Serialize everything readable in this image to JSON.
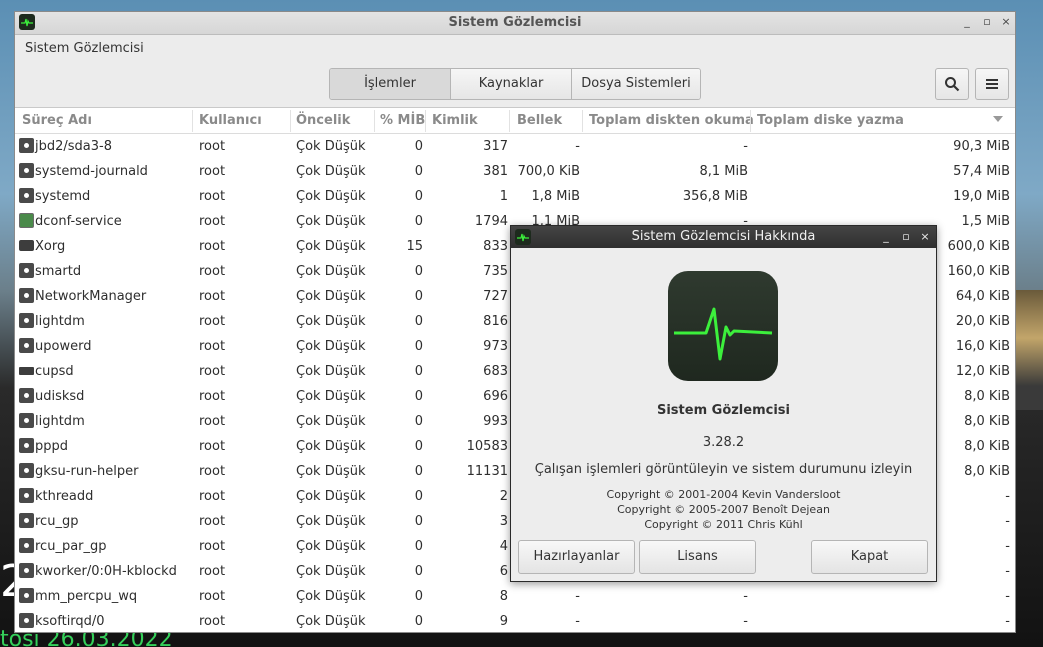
{
  "desktop": {
    "left_text": "2",
    "bottom_text": "tosi 26.03.2022"
  },
  "window": {
    "title": "Sistem Gözlemcisi",
    "menu_label": "Sistem Gözlemcisi",
    "minimize_label": "_",
    "maximize_label": "▫",
    "close_label": "×"
  },
  "toolbar": {
    "tabs": [
      {
        "label": "İşlemler",
        "active": true
      },
      {
        "label": "Kaynaklar",
        "active": false
      },
      {
        "label": "Dosya Sistemleri",
        "active": false
      }
    ]
  },
  "columns": [
    "Süreç Adı",
    "Kullanıcı",
    "Öncelik",
    "% MİB",
    "Kimlik",
    "Bellek",
    "Toplam diskten okuma",
    "Toplam diske yazma"
  ],
  "processes": [
    {
      "icon": "gear",
      "name": "jbd2/sda3-8",
      "user": "root",
      "priority": "Çok Düşük",
      "cpu": "0",
      "pid": "317",
      "memory": "-",
      "read": "-",
      "write": "90,3 MiB"
    },
    {
      "icon": "gear",
      "name": "systemd-journald",
      "user": "root",
      "priority": "Çok Düşük",
      "cpu": "0",
      "pid": "381",
      "memory": "700,0 KiB",
      "read": "8,1 MiB",
      "write": "57,4 MiB"
    },
    {
      "icon": "gear",
      "name": "systemd",
      "user": "root",
      "priority": "Çok Düşük",
      "cpu": "0",
      "pid": "1",
      "memory": "1,8 MiB",
      "read": "356,8 MiB",
      "write": "19,0 MiB"
    },
    {
      "icon": "dconf",
      "name": "dconf-service",
      "user": "root",
      "priority": "Çok Düşük",
      "cpu": "0",
      "pid": "1794",
      "memory": "1,1 MiB",
      "read": "-",
      "write": "1,5 MiB"
    },
    {
      "icon": "screen",
      "name": "Xorg",
      "user": "root",
      "priority": "Çok Düşük",
      "cpu": "15",
      "pid": "833",
      "memory": "",
      "read": "",
      "write": "600,0 KiB"
    },
    {
      "icon": "gear",
      "name": "smartd",
      "user": "root",
      "priority": "Çok Düşük",
      "cpu": "0",
      "pid": "735",
      "memory": "",
      "read": "",
      "write": "160,0 KiB"
    },
    {
      "icon": "gear",
      "name": "NetworkManager",
      "user": "root",
      "priority": "Çok Düşük",
      "cpu": "0",
      "pid": "727",
      "memory": "",
      "read": "",
      "write": "64,0 KiB"
    },
    {
      "icon": "gear",
      "name": "lightdm",
      "user": "root",
      "priority": "Çok Düşük",
      "cpu": "0",
      "pid": "816",
      "memory": "",
      "read": "",
      "write": "20,0 KiB"
    },
    {
      "icon": "gear",
      "name": "upowerd",
      "user": "root",
      "priority": "Çok Düşük",
      "cpu": "0",
      "pid": "973",
      "memory": "",
      "read": "",
      "write": "16,0 KiB"
    },
    {
      "icon": "printer",
      "name": "cupsd",
      "user": "root",
      "priority": "Çok Düşük",
      "cpu": "0",
      "pid": "683",
      "memory": "",
      "read": "",
      "write": "12,0 KiB"
    },
    {
      "icon": "gear",
      "name": "udisksd",
      "user": "root",
      "priority": "Çok Düşük",
      "cpu": "0",
      "pid": "696",
      "memory": "",
      "read": "",
      "write": "8,0 KiB"
    },
    {
      "icon": "gear",
      "name": "lightdm",
      "user": "root",
      "priority": "Çok Düşük",
      "cpu": "0",
      "pid": "993",
      "memory": "",
      "read": "",
      "write": "8,0 KiB"
    },
    {
      "icon": "gear",
      "name": "pppd",
      "user": "root",
      "priority": "Çok Düşük",
      "cpu": "0",
      "pid": "10583",
      "memory": "",
      "read": "",
      "write": "8,0 KiB"
    },
    {
      "icon": "gear",
      "name": "gksu-run-helper",
      "user": "root",
      "priority": "Çok Düşük",
      "cpu": "0",
      "pid": "11131",
      "memory": "",
      "read": "",
      "write": "8,0 KiB"
    },
    {
      "icon": "gear",
      "name": "kthreadd",
      "user": "root",
      "priority": "Çok Düşük",
      "cpu": "0",
      "pid": "2",
      "memory": "",
      "read": "",
      "write": "-"
    },
    {
      "icon": "gear",
      "name": "rcu_gp",
      "user": "root",
      "priority": "Çok Düşük",
      "cpu": "0",
      "pid": "3",
      "memory": "",
      "read": "",
      "write": "-"
    },
    {
      "icon": "gear",
      "name": "rcu_par_gp",
      "user": "root",
      "priority": "Çok Düşük",
      "cpu": "0",
      "pid": "4",
      "memory": "",
      "read": "",
      "write": "-"
    },
    {
      "icon": "gear",
      "name": "kworker/0:0H-kblockd",
      "user": "root",
      "priority": "Çok Düşük",
      "cpu": "0",
      "pid": "6",
      "memory": "",
      "read": "",
      "write": "-"
    },
    {
      "icon": "gear",
      "name": "mm_percpu_wq",
      "user": "root",
      "priority": "Çok Düşük",
      "cpu": "0",
      "pid": "8",
      "memory": "-",
      "read": "-",
      "write": "-"
    },
    {
      "icon": "gear",
      "name": "ksoftirqd/0",
      "user": "root",
      "priority": "Çok Düşük",
      "cpu": "0",
      "pid": "9",
      "memory": "-",
      "read": "-",
      "write": "-"
    }
  ],
  "about_dialog": {
    "title": "Sistem Gözlemcisi Hakkında",
    "app_name": "Sistem Gözlemcisi",
    "version": "3.28.2",
    "description": "Çalışan işlemleri görüntüleyin ve sistem durumunu izleyin",
    "copyright": [
      "Copyright © 2001-2004 Kevin Vandersloot",
      "Copyright © 2005-2007 Benoît Dejean",
      "Copyright © 2011 Chris Kühl"
    ],
    "buttons": {
      "credits": "Hazırlayanlar",
      "license": "Lisans",
      "close": "Kapat"
    }
  },
  "colors": {
    "accent_green": "#3cf03c",
    "dialog_title_bg": "#3a3a3a"
  }
}
